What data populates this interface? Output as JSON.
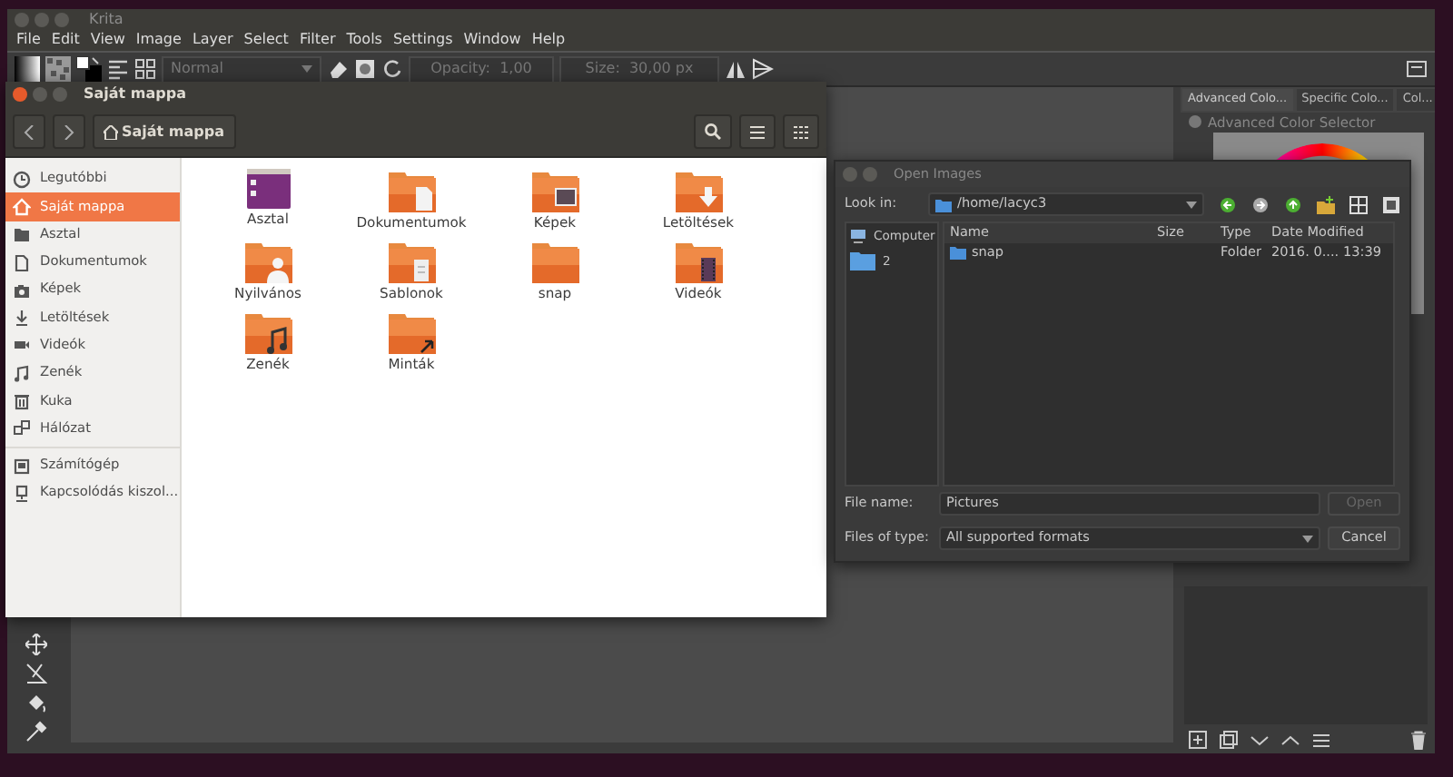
{
  "krita": {
    "title": "Krita",
    "menu": [
      "File",
      "Edit",
      "View",
      "Image",
      "Layer",
      "Select",
      "Filter",
      "Tools",
      "Settings",
      "Window",
      "Help"
    ],
    "blend_mode": "Normal",
    "opacity_label": "Opacity:",
    "opacity": "1,00",
    "size_label": "Size:",
    "size": "30,00 px",
    "docker_tabs": [
      {
        "label": "Advanced Colo...",
        "selected": true
      },
      {
        "label": "Specific Colo...",
        "selected": false
      },
      {
        "label": "Col...",
        "selected": false
      }
    ],
    "docker_title": "Advanced Color Selector"
  },
  "file_manager": {
    "title": "Saját mappa",
    "path_button": "Saját mappa",
    "sidebar": [
      {
        "label": "Legutóbbi",
        "kind": "clock",
        "selected": false
      },
      {
        "label": "Saját mappa",
        "kind": "home",
        "selected": true
      },
      {
        "label": "Asztal",
        "kind": "folder",
        "selected": false
      },
      {
        "label": "Dokumentumok",
        "kind": "document",
        "selected": false
      },
      {
        "label": "Képek",
        "kind": "camera",
        "selected": false
      },
      {
        "label": "Letöltések",
        "kind": "download",
        "selected": false
      },
      {
        "label": "Videók",
        "kind": "video",
        "selected": false
      },
      {
        "label": "Zenék",
        "kind": "music",
        "selected": false
      },
      {
        "label": "Kuka",
        "kind": "trash",
        "selected": false
      },
      {
        "label": "Hálózat",
        "kind": "network",
        "selected": false
      }
    ],
    "sidebar_devices": [
      {
        "label": "Számítógép",
        "kind": "computer",
        "selected": false
      },
      {
        "label": "Kapcsolódás kiszol...",
        "kind": "server",
        "selected": false
      }
    ],
    "folders": [
      {
        "label": "Asztal",
        "kind": "desktop"
      },
      {
        "label": "Dokumentumok",
        "kind": "document"
      },
      {
        "label": "Képek",
        "kind": "picture"
      },
      {
        "label": "Letöltések",
        "kind": "download"
      },
      {
        "label": "Nyilvános",
        "kind": "public"
      },
      {
        "label": "Sablonok",
        "kind": "template"
      },
      {
        "label": "snap",
        "kind": "plain"
      },
      {
        "label": "Videók",
        "kind": "video"
      },
      {
        "label": "Zenék",
        "kind": "music"
      },
      {
        "label": "Minták",
        "kind": "link"
      }
    ]
  },
  "open_dialog": {
    "title": "Open Images",
    "look_in_label": "Look in:",
    "look_in": "/home/lacyc3",
    "places": [
      {
        "label": "Computer",
        "kind": "computer"
      },
      {
        "label": "2",
        "kind": "folder"
      }
    ],
    "columns": [
      "Name",
      "Size",
      "Type",
      "Date Modified"
    ],
    "rows": [
      {
        "name": "snap",
        "type": "Folder",
        "date": "2016. 0.... 13:39"
      }
    ],
    "file_name_label": "File name:",
    "file_name": "Pictures",
    "files_of_type_label": "Files of type:",
    "files_of_type": "All supported formats",
    "buttons": [
      {
        "label": "Open",
        "disabled": true
      },
      {
        "label": "Cancel",
        "disabled": false
      }
    ]
  }
}
